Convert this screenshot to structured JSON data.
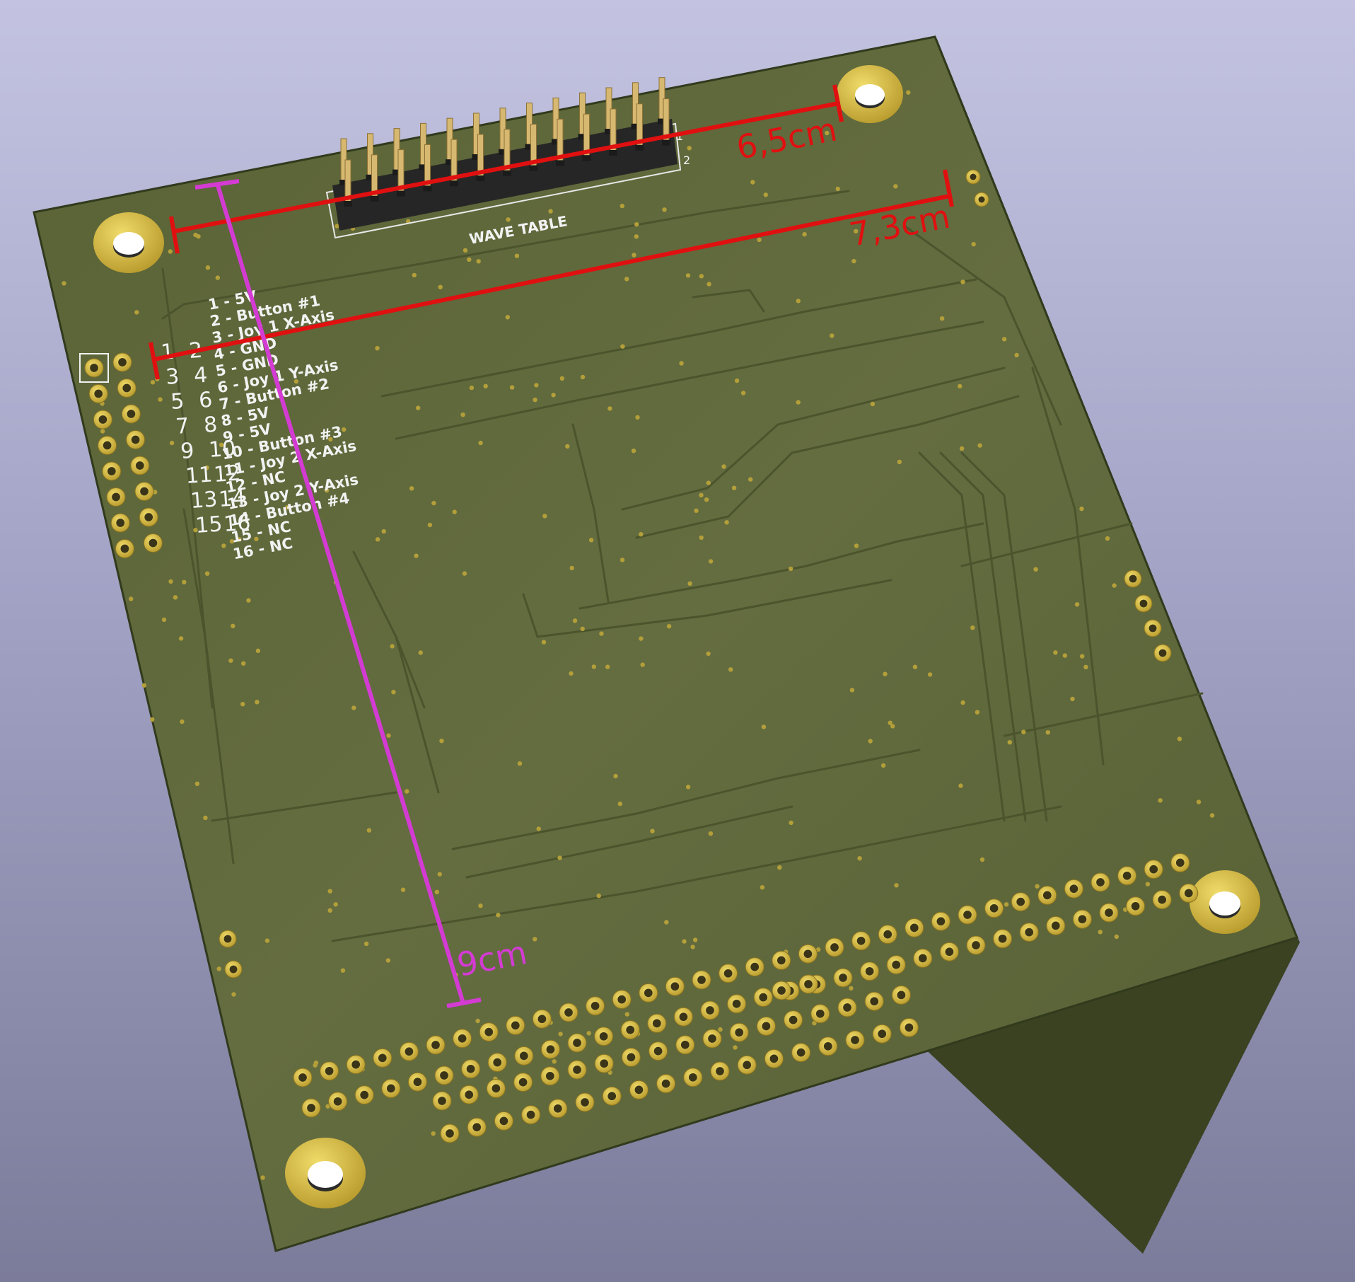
{
  "colors": {
    "background_top": "#c3c3e1",
    "background_bottom": "#7b7b9a",
    "board": "#5c6538",
    "board_edge": "#3f4726",
    "trace": "#4c552d",
    "gold": "#d8c24a",
    "silkscreen": "#f2f2f2",
    "dimension_red": "#e01010",
    "dimension_magenta": "#d33bd3"
  },
  "board": {
    "header_label": "WAVE TABLE",
    "header_pin_1": "1",
    "header_pin_2": "2",
    "left_header_grid": [
      [
        "1",
        "2"
      ],
      [
        "3",
        "4"
      ],
      [
        "5",
        "6"
      ],
      [
        "7",
        "8"
      ],
      [
        "9",
        "10"
      ],
      [
        "11",
        "12"
      ],
      [
        "13",
        "14"
      ],
      [
        "15",
        "16"
      ]
    ],
    "pinout": [
      "1 - 5V",
      "2 - Button #1",
      "3 - Joy 1 X-Axis",
      "4 - GND",
      "5 - GND",
      "6 - Joy 1 Y-Axis",
      "7 - Button #2",
      "8 - 5V",
      "9 - 5V",
      "10 - Button #3",
      "11 - Joy 2 X-Axis",
      "12 - NC",
      "13 - Joy 2 Y-Axis",
      "14 - Button #4",
      "15 - NC",
      "16 - NC"
    ]
  },
  "dimensions": {
    "width_inner": "6,5cm",
    "width_outer": "7,3cm",
    "height": "9cm"
  }
}
